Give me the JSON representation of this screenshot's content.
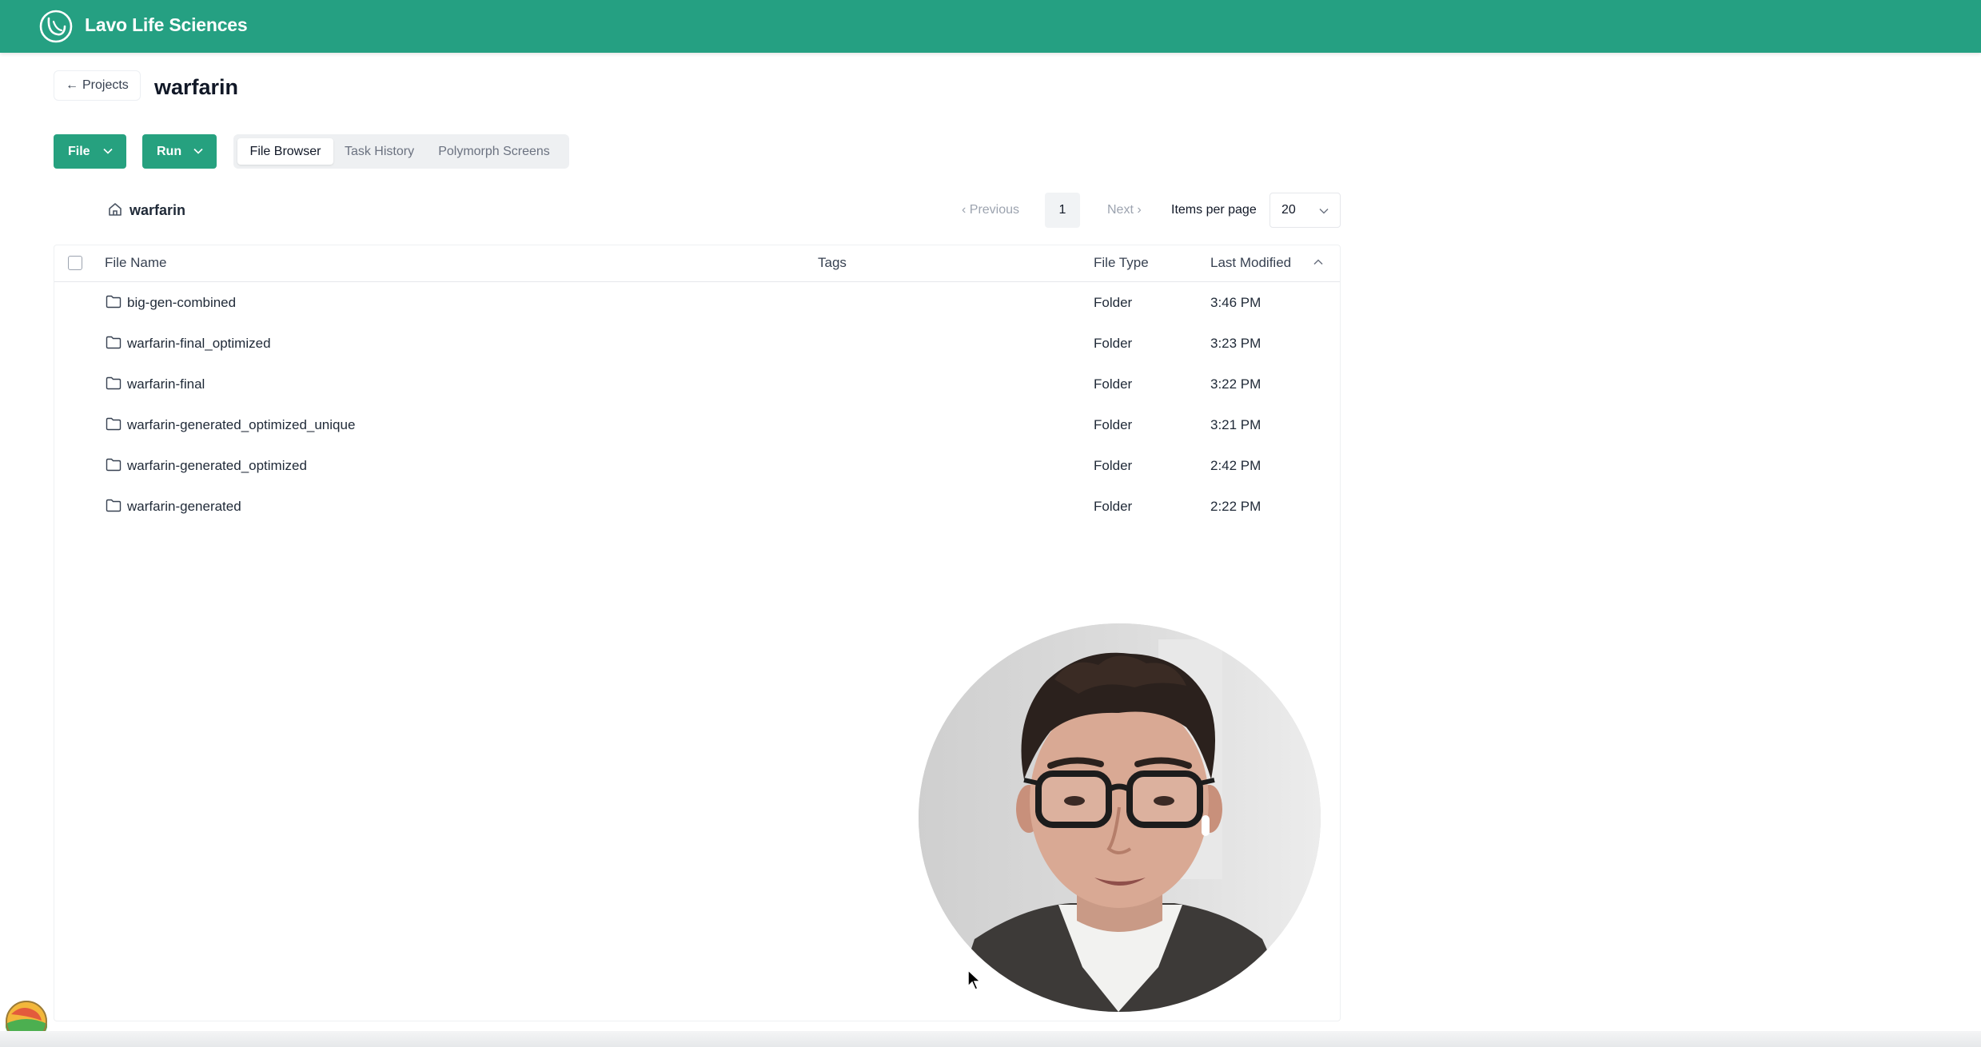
{
  "header": {
    "brand": "Lavo Life Sciences",
    "color": "#25a082"
  },
  "nav": {
    "back_label": "Projects",
    "project_title": "warfarin"
  },
  "toolbar": {
    "file_label": "File",
    "run_label": "Run",
    "tabs": [
      {
        "label": "File Browser",
        "active": true
      },
      {
        "label": "Task History",
        "active": false
      },
      {
        "label": "Polymorph Screens",
        "active": false
      }
    ]
  },
  "browser": {
    "breadcrumb": "warfarin",
    "pagination": {
      "previous_label": "Previous",
      "current_page": "1",
      "next_label": "Next",
      "items_per_page_label": "Items per page",
      "items_per_page_value": "20"
    },
    "columns": {
      "name": "File Name",
      "tags": "Tags",
      "type": "File Type",
      "modified": "Last Modified"
    },
    "sort": {
      "column": "Last Modified",
      "direction": "ascending-indicator"
    },
    "rows": [
      {
        "name": "big-gen-combined",
        "tags": "",
        "type": "Folder",
        "modified": "3:46 PM"
      },
      {
        "name": "warfarin-final_optimized",
        "tags": "",
        "type": "Folder",
        "modified": "3:23 PM"
      },
      {
        "name": "warfarin-final",
        "tags": "",
        "type": "Folder",
        "modified": "3:22 PM"
      },
      {
        "name": "warfarin-generated_optimized_unique",
        "tags": "",
        "type": "Folder",
        "modified": "3:21 PM"
      },
      {
        "name": "warfarin-generated_optimized",
        "tags": "",
        "type": "Folder",
        "modified": "2:42 PM"
      },
      {
        "name": "warfarin-generated",
        "tags": "",
        "type": "Folder",
        "modified": "2:22 PM"
      }
    ]
  },
  "overlay": {
    "webcam": "presenter webcam bubble",
    "icons": [
      "logo-icon",
      "home-icon",
      "folder-icon",
      "chevron-down-icon",
      "chevron-up-icon",
      "arrow-left-icon",
      "cursor-icon",
      "dock-app-icon"
    ]
  }
}
